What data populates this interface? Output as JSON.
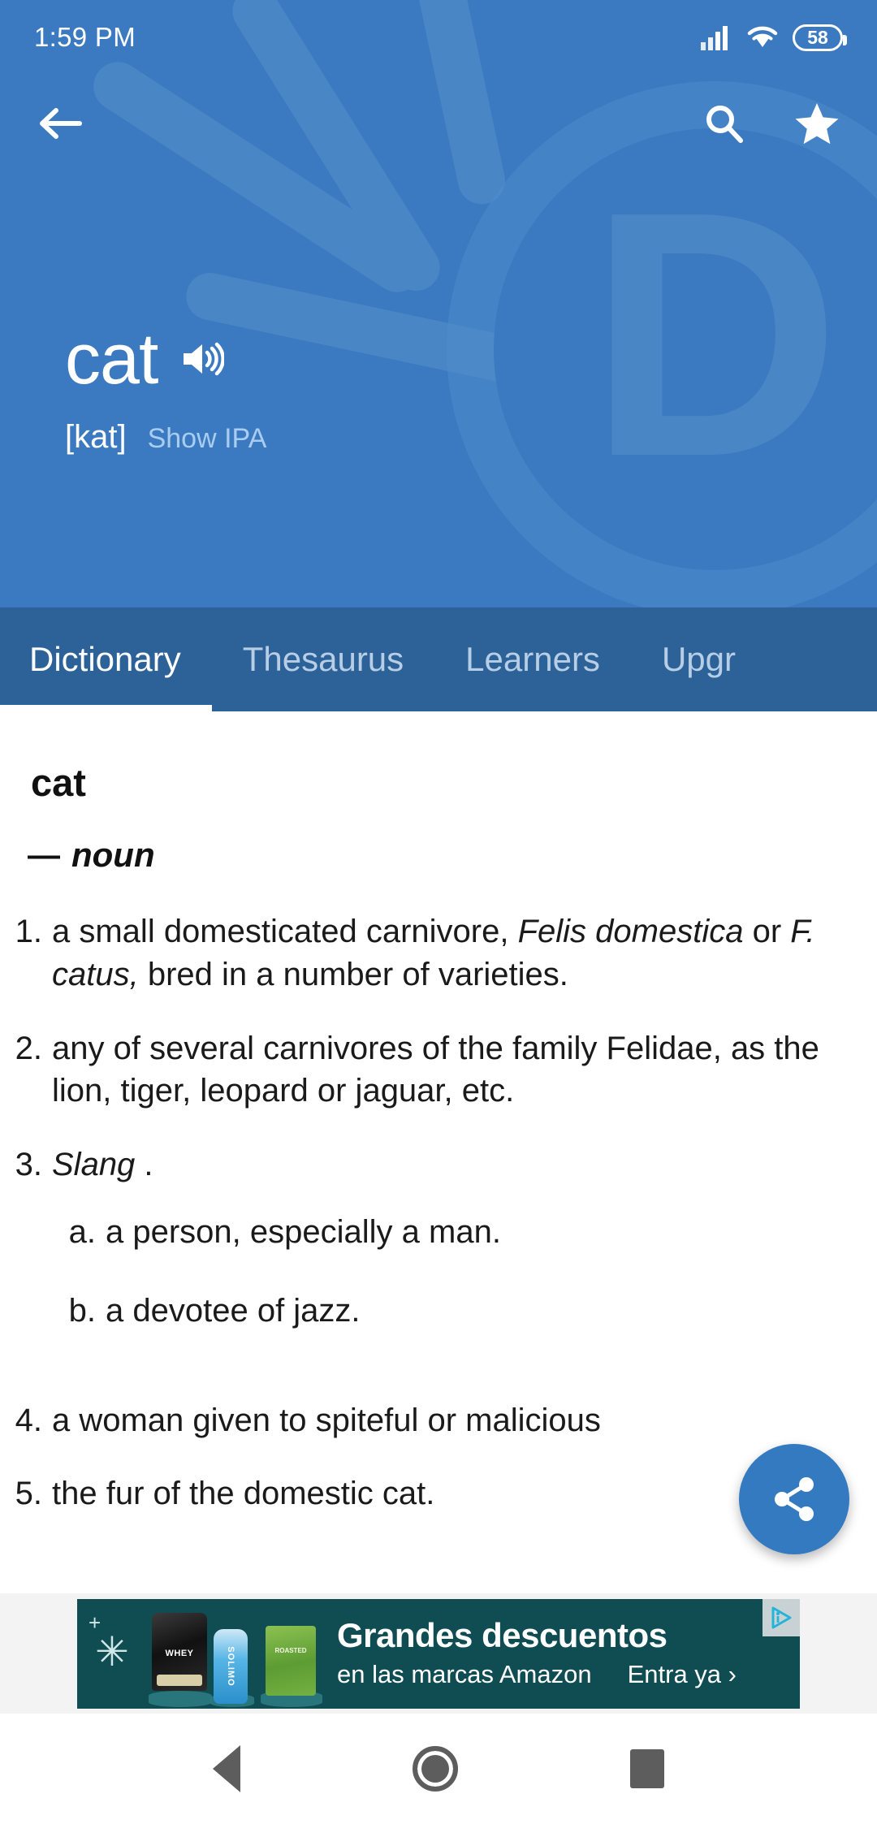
{
  "status_bar": {
    "time": "1:59 PM",
    "battery_level": "58",
    "signal_icon": "signal-bars-icon",
    "wifi_icon": "wifi-icon"
  },
  "app_bar": {
    "back_icon": "back-arrow-icon",
    "search_icon": "search-icon",
    "favorite_icon": "star-icon"
  },
  "header": {
    "headword": "cat",
    "audio_icon": "speaker-icon",
    "pronunciation": "[kat]",
    "show_ipa_label": "Show IPA",
    "background_color": "#3b7ac0",
    "watermark_letter": "D"
  },
  "tabs": [
    {
      "label": "Dictionary",
      "active": true
    },
    {
      "label": "Thesaurus",
      "active": false
    },
    {
      "label": "Learners",
      "active": false
    },
    {
      "label": "Upgr",
      "active": false
    }
  ],
  "entry": {
    "word": "cat",
    "pos_dash": "—",
    "part_of_speech": "noun",
    "definitions": [
      {
        "num": "1.",
        "segments": [
          {
            "text": "a small domesticated carnivore, ",
            "italic": false
          },
          {
            "text": "Felis domestica",
            "italic": true
          },
          {
            "text": " or ",
            "italic": false
          },
          {
            "text": "F. catus,",
            "italic": true
          },
          {
            "text": " bred in a number of varieties.",
            "italic": false
          }
        ]
      },
      {
        "num": "2.",
        "segments": [
          {
            "text": "any of several carnivores of the family Felidae, as the lion, tiger, leopard or jaguar, etc.",
            "italic": false
          }
        ]
      },
      {
        "num": "3.",
        "segments": [
          {
            "text": "Slang",
            "italic": true
          },
          {
            "text": " .",
            "italic": false
          }
        ],
        "subdefinitions": [
          {
            "num": "a.",
            "text": "a person, especially a man."
          },
          {
            "num": "b.",
            "text": "a devotee of jazz."
          }
        ]
      },
      {
        "num": "4.",
        "segments": [
          {
            "text": "a woman given to spiteful or malicious",
            "italic": false
          }
        ]
      },
      {
        "num": "5.",
        "segments": [
          {
            "text": "the fur of the domestic cat.",
            "italic": false
          }
        ]
      }
    ]
  },
  "share_button": {
    "icon": "share-icon",
    "color": "#337ac0"
  },
  "ad": {
    "headline": "Grandes descuentos",
    "subline": "en las marcas Amazon",
    "cta": "Entra ya ›",
    "adchoices_icon": "adchoices-icon",
    "background_color": "#0f4d53",
    "products": [
      "whey-protein-bag",
      "solimo-bottle",
      "roasted-pistachios-bag"
    ]
  },
  "nav_bar": {
    "back_icon": "nav-back-icon",
    "home_icon": "nav-home-icon",
    "recents_icon": "nav-recents-icon"
  }
}
